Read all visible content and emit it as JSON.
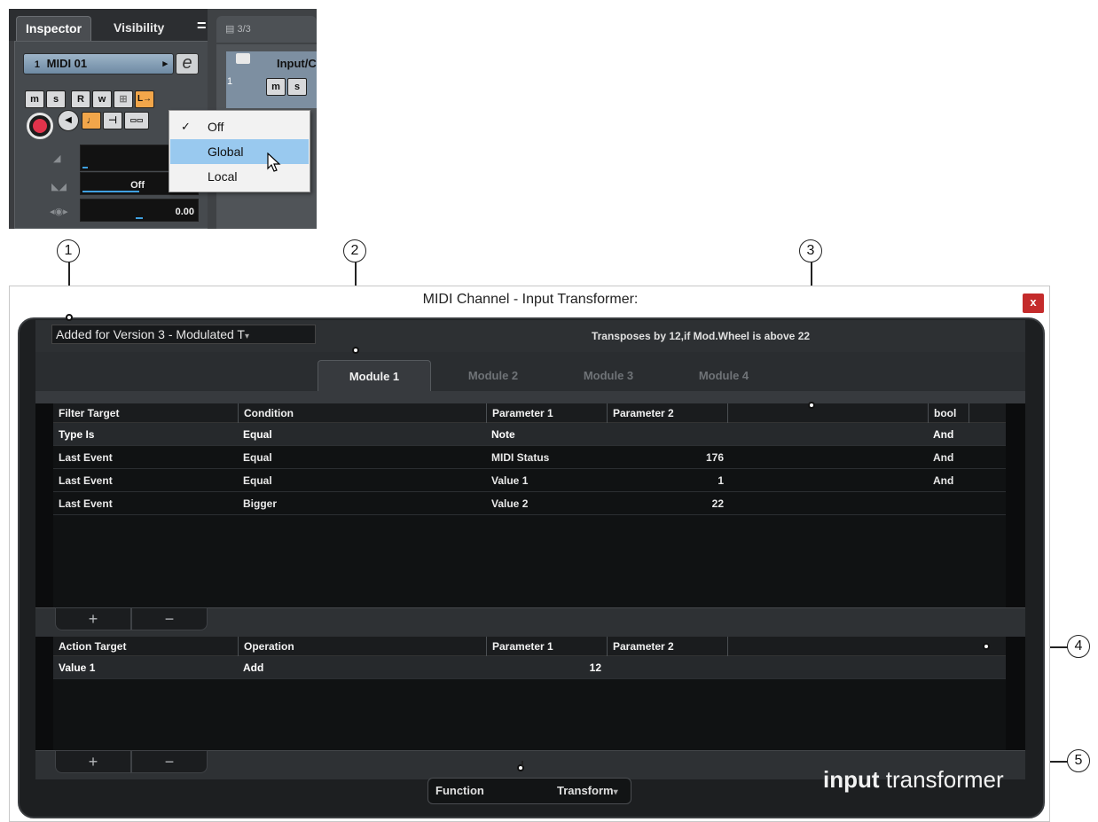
{
  "inspector": {
    "tabs": [
      "Inspector",
      "Visibility"
    ],
    "menu_icon": "=",
    "track_number": "1",
    "track_name": "MIDI 01",
    "track_name_arrow": "▸",
    "edit_button": "e",
    "buttons_row1": [
      "m",
      "s",
      "R",
      "w",
      "⊞",
      "L→"
    ],
    "buttons_row2": [
      "♩",
      "⊣",
      "▭▭"
    ],
    "volume_value": "",
    "pan_value": "Off",
    "delay_value": "0.00"
  },
  "track_list": {
    "header": "3/3",
    "track_label": "Input/C",
    "track_number": "1",
    "buttons": [
      "m",
      "s"
    ]
  },
  "popup_menu": {
    "items": [
      {
        "label": "Off",
        "checked": true
      },
      {
        "label": "Global",
        "highlighted": true
      },
      {
        "label": "Local"
      }
    ]
  },
  "callouts": [
    "1",
    "2",
    "3",
    "4",
    "5"
  ],
  "window": {
    "title": "MIDI Channel - Input Transformer:",
    "close_label": "x",
    "preset": "Added for Version 3 - Modulated T",
    "preset_arrow": "▾",
    "description": "Transposes by 12,if Mod.Wheel is above 22",
    "modules": [
      "Module 1",
      "Module 2",
      "Module 3",
      "Module 4"
    ],
    "active_module": 0,
    "filter_table": {
      "headers": [
        "Filter Target",
        "Condition",
        "Parameter 1",
        "Parameter 2",
        "",
        "bool"
      ],
      "rows": [
        {
          "target": "Type Is",
          "condition": "Equal",
          "param1": "Note",
          "param2": "",
          "bool": "And"
        },
        {
          "target": "Last Event",
          "condition": "Equal",
          "param1": "MIDI Status",
          "param2": "176",
          "bool": "And"
        },
        {
          "target": "Last Event",
          "condition": "Equal",
          "param1": "Value 1",
          "param2": "1",
          "bool": "And"
        },
        {
          "target": "Last Event",
          "condition": "Bigger",
          "param1": "Value 2",
          "param2": "22",
          "bool": ""
        }
      ]
    },
    "action_table": {
      "headers": [
        "Action Target",
        "Operation",
        "Parameter 1",
        "Parameter 2"
      ],
      "rows": [
        {
          "target": "Value 1",
          "operation": "Add",
          "param1": "12",
          "param2": ""
        }
      ]
    },
    "add_label": "+",
    "remove_label": "−",
    "function_label": "Function",
    "function_value": "Transform",
    "brand_bold": "input",
    "brand_rest": " transformer"
  }
}
